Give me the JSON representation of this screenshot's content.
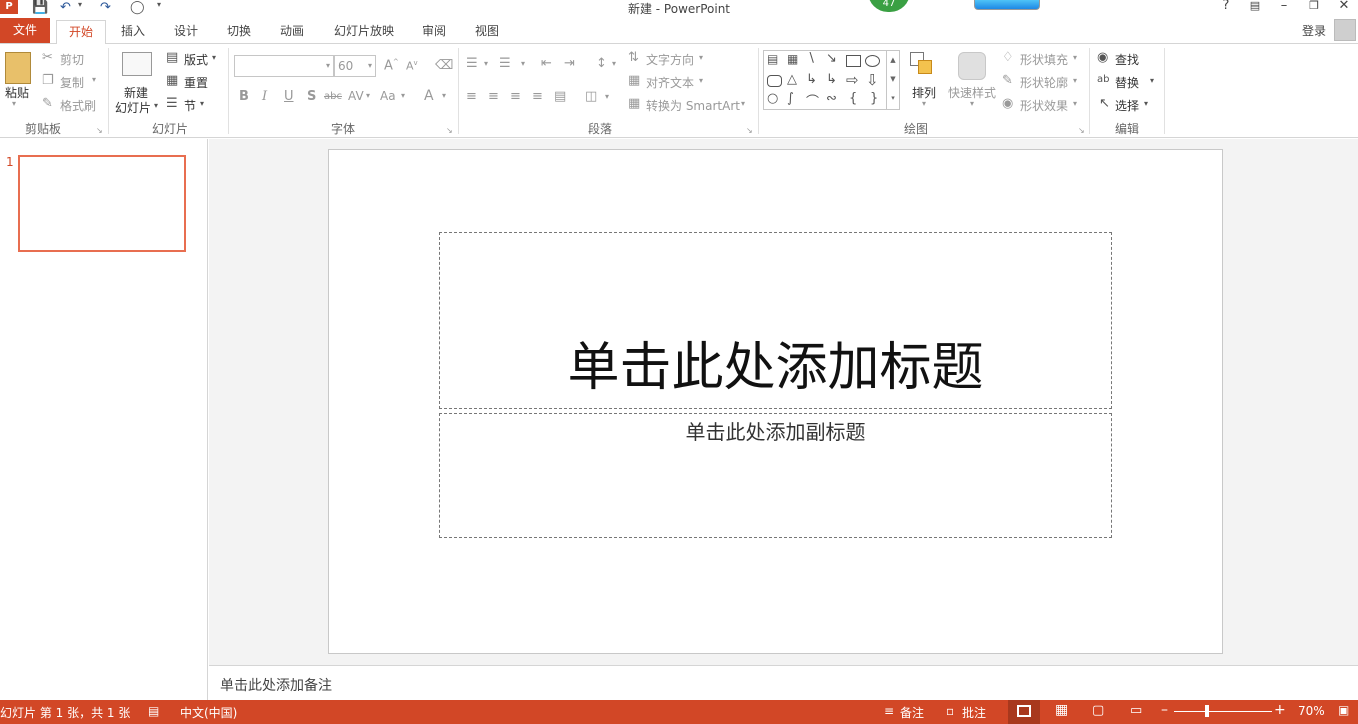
{
  "titlebar": {
    "title": "新建 - PowerPoint",
    "badge_number": "47"
  },
  "tabs": [
    "文件",
    "开始",
    "插入",
    "设计",
    "切换",
    "动画",
    "幻灯片放映",
    "审阅",
    "视图"
  ],
  "signin": "登录",
  "ribbon": {
    "clipboard": {
      "paste": "粘贴",
      "cut": "剪切",
      "copy": "复制",
      "format_painter": "格式刷",
      "group": "剪贴板"
    },
    "slides": {
      "new_slide_line1": "新建",
      "new_slide_line2": "幻灯片",
      "layout": "版式",
      "reset": "重置",
      "section": "节",
      "group": "幻灯片"
    },
    "font": {
      "font_name": "",
      "font_size": "60",
      "bold": "B",
      "italic": "I",
      "underline": "U",
      "shadow": "S",
      "strike": "abc",
      "spacing": "AV",
      "case": "Aa",
      "color": "A",
      "grow": "A",
      "shrink": "A",
      "group": "字体"
    },
    "paragraph": {
      "text_direction": "文字方向",
      "align_text": "对齐文本",
      "smartart": "转换为 SmartArt",
      "group": "段落"
    },
    "drawing": {
      "arrange": "排列",
      "quick_styles": "快速样式",
      "shape_fill": "形状填充",
      "shape_outline": "形状轮廓",
      "shape_effects": "形状效果",
      "group": "绘图"
    },
    "editing": {
      "find": "查找",
      "replace": "替换",
      "select": "选择",
      "group": "编辑"
    }
  },
  "thumbnails": [
    {
      "number": "1"
    }
  ],
  "slide": {
    "title_placeholder": "单击此处添加标题",
    "subtitle_placeholder": "单击此处添加副标题"
  },
  "notes_placeholder": "单击此处添加备注",
  "statusbar": {
    "slide_info": "幻灯片 第 1 张，共 1 张",
    "language": "中文(中国)",
    "notes": "备注",
    "comments": "批注",
    "zoom": "70%"
  },
  "colors": {
    "accent": "#d24726",
    "thumb_border": "#e86e50"
  }
}
